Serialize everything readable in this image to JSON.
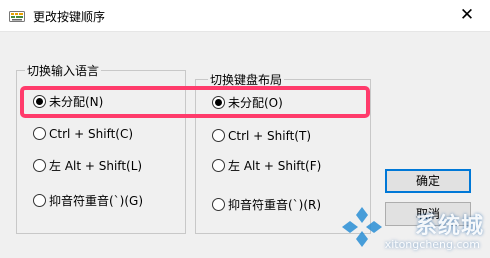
{
  "window": {
    "title": "更改按键顺序",
    "close_glyph": "✕"
  },
  "input_language_group": {
    "legend": "切换输入语言",
    "options": [
      {
        "label": "未分配(N)",
        "checked": true
      },
      {
        "label": "Ctrl + Shift(C)",
        "checked": false
      },
      {
        "label": "左 Alt + Shift(L)",
        "checked": false
      },
      {
        "label": "抑音符重音(`)(G)",
        "checked": false
      }
    ]
  },
  "keyboard_layout_group": {
    "legend": "切换键盘布局",
    "options": [
      {
        "label": "未分配(O)",
        "checked": true
      },
      {
        "label": "Ctrl + Shift(T)",
        "checked": false
      },
      {
        "label": "左 Alt + Shift(F)",
        "checked": false
      },
      {
        "label": "抑音符重音(`)(R)",
        "checked": false
      }
    ]
  },
  "buttons": {
    "ok": "确定",
    "cancel": "取消"
  },
  "watermark": {
    "text": "系统城",
    "url": "xitongcheng.com"
  },
  "colors": {
    "highlight": "#ff3b6b",
    "accent": "#0078d7"
  }
}
